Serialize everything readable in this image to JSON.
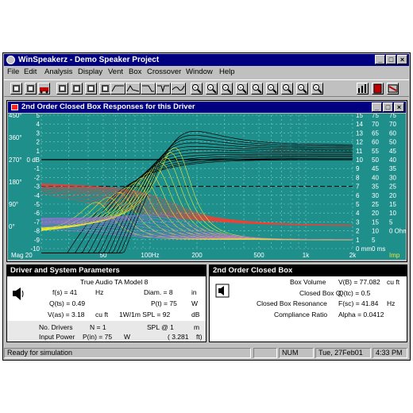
{
  "window": {
    "title": "WinSpeakerz - Demo Speaker Project"
  },
  "menu": [
    "File",
    "Edit",
    "Analysis",
    "Display",
    "Vent",
    "Box",
    "Crossover",
    "Window",
    "Help"
  ],
  "toolbar_icons": [
    "open-icon",
    "new-icon",
    "car-icon",
    "cabinet-icon",
    "save-icon",
    "vent-icon",
    "box-icon",
    "highpass-icon",
    "bandpass-icon",
    "lowpass-icon",
    "notch-icon",
    "curve-icon",
    "zoom-icon",
    "zoom-icon",
    "zoom-icon",
    "zoom-icon",
    "zoom-icon",
    "zoom-icon",
    "zoom-icon",
    "zoom-icon",
    "zoom-icon",
    "graph-icon",
    "calc-icon",
    "flag-icon"
  ],
  "chart_window": {
    "title": "2nd Order Closed Box Responses for this Driver"
  },
  "chart_data": {
    "type": "line",
    "left_phase_ticks": [
      "450°",
      "360°",
      "270°",
      "180°",
      "90°",
      "0°"
    ],
    "left_db_ticks": [
      "5",
      "4",
      "3",
      "2",
      "1",
      "0 dB",
      "-1",
      "-2",
      "-3",
      "-4",
      "-5",
      "-6",
      "-7",
      "-8",
      "-9",
      "-10"
    ],
    "right_ticks_a": [
      "15",
      "14",
      "13",
      "12",
      "11",
      "10",
      "9",
      "8",
      "7",
      "6",
      "5",
      "4",
      "3",
      "2",
      "1",
      "0 mm"
    ],
    "right_ticks_b": [
      "75",
      "70",
      "65",
      "60",
      "55",
      "50",
      "45",
      "40",
      "35",
      "30",
      "25",
      "20",
      "15",
      "10",
      "5",
      "0 ms"
    ],
    "right_ticks_c": [
      "75",
      "70",
      "60",
      "50",
      "45",
      "40",
      "35",
      "30",
      "25",
      "20",
      "15",
      "10",
      "5",
      "0 Ohm"
    ],
    "x_ticks": [
      "Mag 20",
      "50",
      "100Hz",
      "200",
      "500",
      "1k",
      "2k"
    ],
    "x_values": [
      20,
      50,
      100,
      200,
      500,
      1000,
      2000
    ],
    "imp_label": "Imp",
    "colors": {
      "bg": "#1f8f8c",
      "magnitude": "#000000",
      "phase": "#ff3b30",
      "delay": "#e8e832",
      "excursion": "#b06cd8",
      "grid": "#7fd0cc"
    }
  },
  "driver_panel": {
    "title": "Driver and System Parameters",
    "model": "True Audio TA Model 8",
    "rows": [
      {
        "l": "f(s) = 41",
        "u": "Hz",
        "l2": "Diam. = 8",
        "u2": "in"
      },
      {
        "l": "Q(ts) = 0.49",
        "u": "",
        "l2": "P(t) = 75",
        "u2": "W"
      },
      {
        "l": "V(as) = 3.18",
        "u": "cu ft",
        "l2": "1W/1m SPL = 92",
        "u2": "dB"
      }
    ],
    "drivers": "No. Drivers",
    "drivers_val": "N = 1",
    "spl": "SPL @ 1",
    "spl_unit": "m",
    "power": "Input Power",
    "power_val": "P(in) = 75",
    "power_unit": "W",
    "spl_val": "( 3.281",
    "spl_val_unit": "ft)"
  },
  "box_panel": {
    "title": "2nd Order Closed Box",
    "rows": [
      {
        "label": "Box Volume",
        "val": "V(B) = 77.082",
        "unit": "cu ft"
      },
      {
        "label": "Closed Box Q",
        "val": "Q(tc) = 0.5",
        "unit": ""
      },
      {
        "label": "Closed Box Resonance",
        "val": "F(sc) = 41.84",
        "unit": "Hz"
      },
      {
        "label": "Compliance Ratio",
        "val": "Alpha = 0.0412",
        "unit": ""
      }
    ]
  },
  "status": {
    "left": "Ready for simulation",
    "num": "NUM",
    "date": "Tue, 27Feb01",
    "time": "4:33 PM"
  }
}
